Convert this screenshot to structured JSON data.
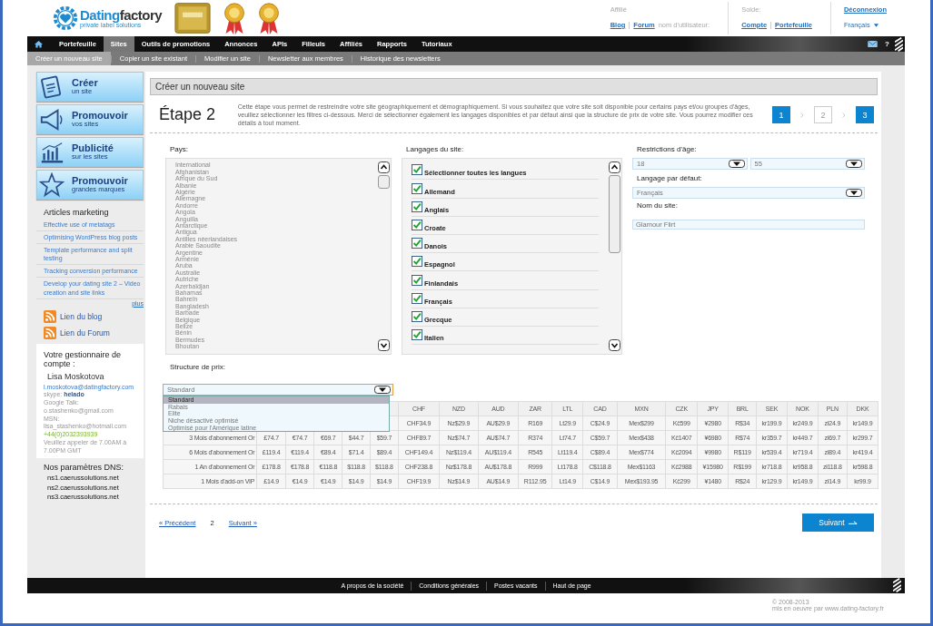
{
  "header": {
    "logo_words": [
      "Dating",
      "factory"
    ],
    "logo_tagline": "private label solutions",
    "affiliate_label": "Affilié",
    "affiliate_links": [
      "Blog",
      "Forum"
    ],
    "username_label": "nom d'utilisateur:",
    "balance_label": "Solde:",
    "balance_links": [
      "Compte",
      "Portefeuille"
    ],
    "logout": "Déconnexion",
    "language": "Français"
  },
  "nav": {
    "items": [
      {
        "label": "Portefeuille",
        "selected": false
      },
      {
        "label": "Sites",
        "selected": true
      },
      {
        "label": "Outils de promotions",
        "selected": false
      },
      {
        "label": "Annonces",
        "selected": false
      },
      {
        "label": "APIs",
        "selected": false
      },
      {
        "label": "Filleuls",
        "selected": false
      },
      {
        "label": "Affiliés",
        "selected": false
      },
      {
        "label": "Rapports",
        "selected": false
      },
      {
        "label": "Tutoriaux",
        "selected": false
      }
    ],
    "help": "?"
  },
  "subnav": [
    {
      "label": "Créer un nouveau site",
      "selected": true
    },
    {
      "label": "Copier un site existant",
      "selected": false
    },
    {
      "label": "Modifier un site",
      "selected": false
    },
    {
      "label": "Newsletter aux membres",
      "selected": false
    },
    {
      "label": "Historique des newsletters",
      "selected": false
    }
  ],
  "sidebar": {
    "actions": [
      {
        "kind": "create",
        "title": "Créer",
        "subtitle": "un site"
      },
      {
        "kind": "promote",
        "title": "Promouvoir",
        "subtitle": "vos sites"
      },
      {
        "kind": "advertise",
        "title": "Publicité",
        "subtitle": "sur les sites"
      },
      {
        "kind": "brands",
        "title": "Promouvoir",
        "subtitle": "grandes marques"
      }
    ],
    "articles": {
      "title": "Articles marketing",
      "links": [
        "Effective use of metatags",
        "Optimising WordPress blog posts",
        "Template performance and split testing",
        "Tracking conversion performance",
        "Develop your dating site 2 – Video creation and site links"
      ],
      "more": "plus"
    },
    "feeds": [
      "Lien du blog",
      "Lien du Forum"
    ],
    "manager": {
      "title": "Votre gestionnaire de compte :",
      "name": "Lisa Moskotova",
      "email": "l.moskotova@datingfactory.com",
      "skype_label": "skype:",
      "skype": "helado",
      "google_talk": "Google Talk: o.stashenko@gmail.com",
      "msn": "MSN: lisa_stashenko@hotmail.com",
      "phone": "+44(0)2032393939",
      "hours": "Veuillez appeler de 7.00AM à 7.00PM GMT"
    },
    "dns": {
      "title": "Nos paramètres DNS:",
      "servers": [
        "ns1.caerussolutions.net",
        "ns2.caerussolutions.net",
        "ns3.caerussolutions.net"
      ]
    }
  },
  "content": {
    "title": "Créer un nouveau site",
    "step_title": "Étape 2",
    "intro": "Cette étape vous permet de restreindre votre site géographiquement et démographiquement. Si vous souhaitez que votre site soit disponible pour certains pays et/ou groupes d'âges, veuillez sélectionner les filtres ci-dessous. Merci de sélectionner également les langages disponibles et par défaut ainsi que la structure de prix de votre site. Vous pourrez modifier ces détails à tout moment.",
    "steps": [
      {
        "label": "1",
        "selected": false
      },
      {
        "label": "2",
        "selected": true
      },
      {
        "label": "3",
        "selected": false
      }
    ],
    "countries": {
      "label": "Pays:",
      "items": [
        "International",
        "Afghanistan",
        "Afrique du Sud",
        "Albanie",
        "Algérie",
        "Allemagne",
        "Andorre",
        "Angola",
        "Anguilla",
        "Antarctique",
        "Antigua",
        "Antilles néerlandaises",
        "Arabie Saoudite",
        "Argentine",
        "Arménie",
        "Aruba",
        "Australie",
        "Autriche",
        "Azerbaïdjan",
        "Bahamas",
        "Bahreïn",
        "Bangladesh",
        "Barbade",
        "Belgique",
        "Belize",
        "Bénin",
        "Bermudes",
        "Bhoutan"
      ]
    },
    "languages": {
      "label": "Langages du site:",
      "items": [
        {
          "label": "Sélectionner toutes les langues",
          "checked": true
        },
        {
          "label": "Allemand",
          "checked": true
        },
        {
          "label": "Anglais",
          "checked": true
        },
        {
          "label": "Croate",
          "checked": true
        },
        {
          "label": "Danois",
          "checked": true
        },
        {
          "label": "Espagnol",
          "checked": true
        },
        {
          "label": "Finlandais",
          "checked": true
        },
        {
          "label": "Français",
          "checked": true
        },
        {
          "label": "Grecque",
          "checked": true
        },
        {
          "label": "Italien",
          "checked": true
        }
      ]
    },
    "age": {
      "label": "Restrictions d'âge:",
      "from": "18",
      "to": "55"
    },
    "default_language": {
      "label": "Langage par défaut:",
      "value": "Français"
    },
    "site_name": {
      "label": "Nom du site:",
      "value": "Glamour Flirt"
    },
    "pricing": {
      "label": "Structure de prix:",
      "value": "Standard",
      "options": [
        {
          "label": "Standard",
          "selected": true
        },
        {
          "label": "Rabais",
          "selected": false
        },
        {
          "label": "Elite",
          "selected": false
        },
        {
          "label": "Niche désactivé optimisé",
          "selected": false
        },
        {
          "label": "Optimisé pour l'Amérique latine",
          "selected": false
        }
      ],
      "header": [
        "CHF",
        "NZD",
        "AUD",
        "ZAR",
        "LTL",
        "CAD",
        "MXN",
        "CZK",
        "JPY",
        "BRL",
        "SEK",
        "NOK",
        "PLN",
        "DKK"
      ],
      "rows": [
        {
          "cells": [
            null,
            null,
            null,
            null,
            null,
            "CHF34.9",
            "Nz$29.9",
            "AU$29.9",
            "R169",
            "Lt29.9",
            "C$24.9",
            "Mex$299",
            "Kč599",
            "¥2980",
            "R$34",
            "kr199.9",
            "kr249.9",
            "zł24.9",
            "kr149.9"
          ]
        },
        {
          "label": "3 Mois d'abonnement Or",
          "cells": [
            "£74.7",
            "€74.7",
            "€69.7",
            "$44.7",
            "$59.7",
            "CHF89.7",
            "Nz$74.7",
            "AU$74.7",
            "R374",
            "Lt74.7",
            "C$59.7",
            "Mex$438",
            "Kč1407",
            "¥6980",
            "R$74",
            "kr359.7",
            "kr449.7",
            "zł69.7",
            "kr299.7"
          ]
        },
        {
          "label": "6 Mois d'abonnement Or",
          "cells": [
            "£119.4",
            "€119.4",
            "€89.4",
            "$71.4",
            "$89.4",
            "CHF149.4",
            "Nz$119.4",
            "AU$119.4",
            "R545",
            "Lt119.4",
            "C$89.4",
            "Mex$774",
            "Kč2094",
            "¥9980",
            "R$119",
            "kr539.4",
            "kr719.4",
            "zł89.4",
            "kr419.4"
          ]
        },
        {
          "label": "1 An d'abonnement Or",
          "cells": [
            "£178.8",
            "€178.8",
            "€118.8",
            "$118.8",
            "$118.8",
            "CHF238.8",
            "Nz$178.8",
            "AU$178.8",
            "R999",
            "Lt178.8",
            "C$118.8",
            "Mex$1163",
            "Kč2988",
            "¥15980",
            "R$199",
            "kr718.8",
            "kr958.8",
            "zł118.8",
            "kr598.8"
          ]
        },
        {
          "label": "1 Mois d'add-on VIP",
          "cells": [
            "£14.9",
            "€14.9",
            "€14.9",
            "$14.9",
            "$14.9",
            "CHF19.9",
            "Nz$14.9",
            "AU$14.9",
            "R112.95",
            "Lt14.9",
            "C$14.9",
            "Mex$193.95",
            "Kč299",
            "¥1480",
            "R$24",
            "kr129.9",
            "kr149.9",
            "zł14.9",
            "kr99.9"
          ]
        }
      ]
    },
    "pager": {
      "previous": "« Précédent",
      "current": "2",
      "next": "Suivant »"
    },
    "next_button": "Suivant"
  },
  "footer": {
    "links": [
      "A propos de la société",
      "Conditions générales",
      "Postes vacants",
      "Haut de page"
    ],
    "copyright": "© 2008-2013",
    "credit": "mis en oeuvre par www.dating-factory.fr"
  }
}
